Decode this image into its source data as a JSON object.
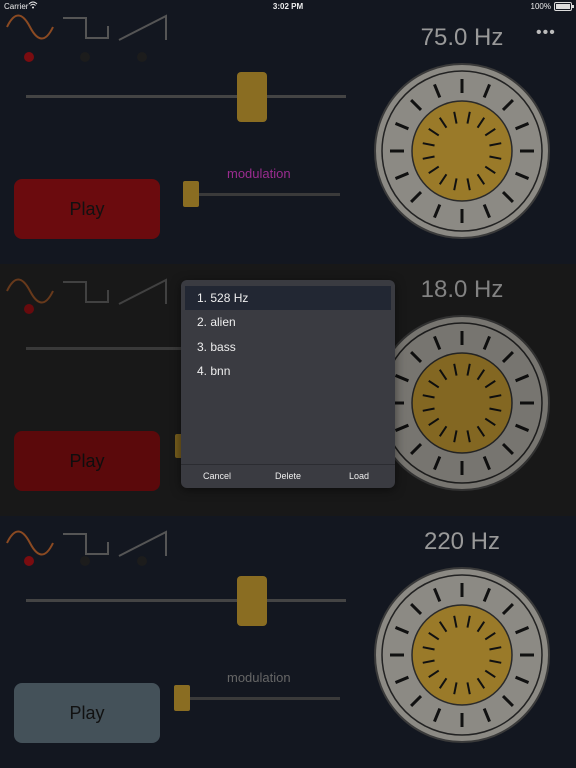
{
  "status_bar": {
    "carrier": "Carrier",
    "time": "3:02 PM",
    "battery": "100%"
  },
  "panels": [
    {
      "frequency": "75.0 Hz",
      "play_label": "Play",
      "modulation_label": "modulation",
      "modulation_color": "#9a2c8f",
      "play_color": "#6b0b0e",
      "active_wave": "sine",
      "frequency_slider_value": 0.82,
      "modulation_slider_value": 0.0
    },
    {
      "frequency": "18.0 Hz",
      "play_label": "Play",
      "play_color": "#6b0b0e",
      "active_wave": "sine",
      "frequency_slider_value": 0.82
    },
    {
      "frequency": "220 Hz",
      "play_label": "Play",
      "modulation_label": "modulation",
      "modulation_color": "#666666",
      "play_color": "#445159",
      "active_wave": "sine",
      "frequency_slider_value": 0.82,
      "modulation_slider_value": 0.0
    }
  ],
  "preset_popover": {
    "items": [
      "1.  528 Hz",
      "2.  alien",
      "3.  bass",
      "4.  bnn"
    ],
    "selected_index": 0,
    "cancel_label": "Cancel",
    "delete_label": "Delete",
    "load_label": "Load"
  },
  "colors": {
    "accent_gold": "#8a6d22",
    "knob_outer": "#8c8a84",
    "knob_inner": "#9a7a29",
    "wave_sine": "#8b4a22",
    "wave_inactive": "#555555"
  },
  "icons": {
    "menu": "more-dots-icon",
    "wifi": "wifi-icon",
    "battery": "battery-icon",
    "sine": "sine-wave-icon",
    "square": "square-wave-icon",
    "saw": "sawtooth-wave-icon"
  }
}
